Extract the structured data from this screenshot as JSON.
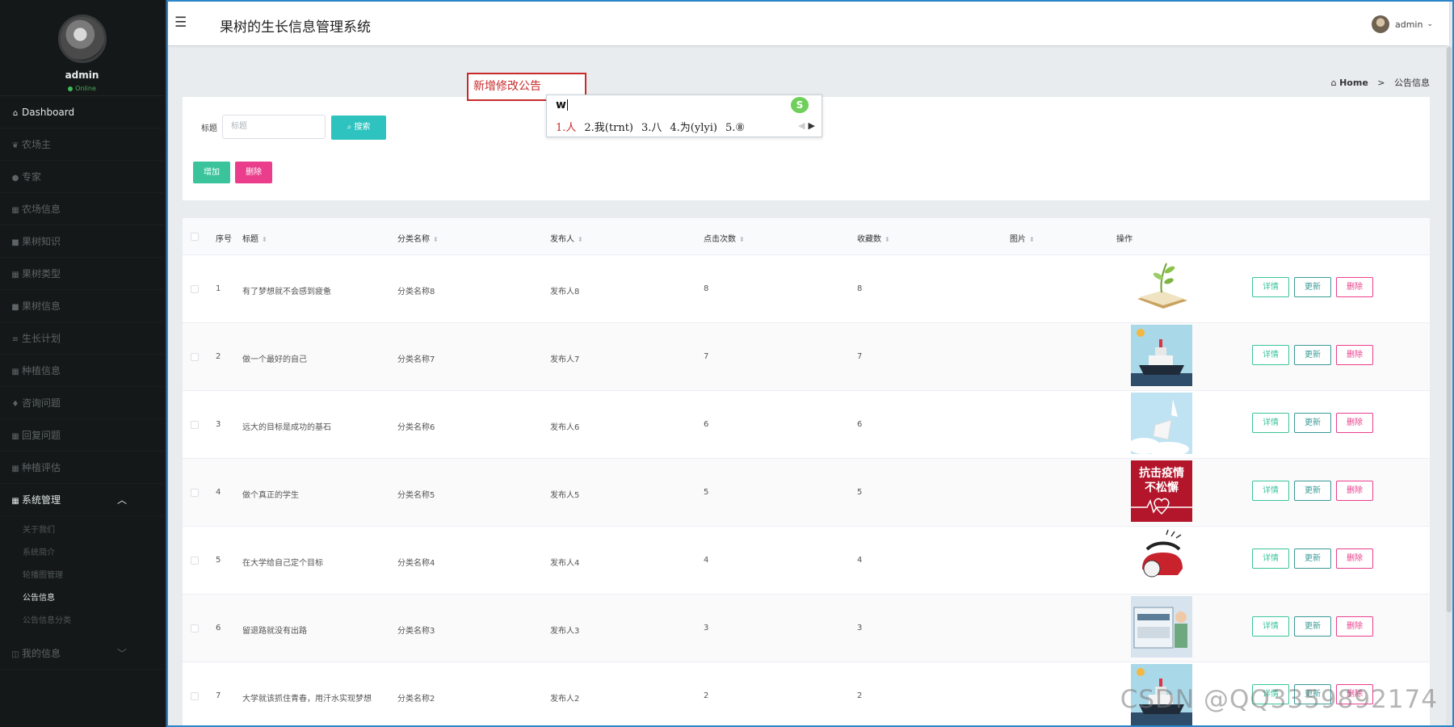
{
  "app": {
    "title": "果树的生长信息管理系统",
    "user": "admin"
  },
  "sidebar": {
    "profile": {
      "name": "admin",
      "status": "Online"
    },
    "items": [
      {
        "label": "Dashboard",
        "icon": "home-icon",
        "glyph": "⌂",
        "active": true
      },
      {
        "label": "农场主",
        "icon": "leaf-icon",
        "glyph": "❦"
      },
      {
        "label": "专家",
        "icon": "chat-icon",
        "glyph": "●"
      },
      {
        "label": "农场信息",
        "icon": "table-icon",
        "glyph": "▦"
      },
      {
        "label": "果树知识",
        "icon": "book-icon",
        "glyph": "■"
      },
      {
        "label": "果树类型",
        "icon": "grid-icon",
        "glyph": "▦"
      },
      {
        "label": "果树信息",
        "icon": "book-icon",
        "glyph": "■"
      },
      {
        "label": "生长计划",
        "icon": "list-icon",
        "glyph": "≡"
      },
      {
        "label": "种植信息",
        "icon": "grid-icon",
        "glyph": "▦"
      },
      {
        "label": "咨询问题",
        "icon": "pin-icon",
        "glyph": "♦"
      },
      {
        "label": "回复问题",
        "icon": "grid-icon",
        "glyph": "▦"
      },
      {
        "label": "种植评估",
        "icon": "grid-icon",
        "glyph": "▦"
      }
    ],
    "system": {
      "label": "系统管理",
      "icon": "grid-icon",
      "glyph": "▦",
      "sub": [
        "关于我们",
        "系统简介",
        "轮播图管理",
        "公告信息",
        "公告信息分类"
      ],
      "current": "公告信息"
    },
    "mine": {
      "label": "我的信息",
      "icon": "user-icon",
      "glyph": "◫"
    }
  },
  "annotation": {
    "text": "新增修改公告"
  },
  "breadcrumb": {
    "home": "Home",
    "sep": ">",
    "current": "公告信息"
  },
  "ime": {
    "code": "w",
    "candidates": [
      "1.人",
      "2.我(trnt)",
      "3.八",
      "4.为(ylyi)",
      "5.⑧"
    ],
    "logo": "S"
  },
  "search": {
    "label": "标题",
    "placeholder": "标题",
    "button": "搜索",
    "add": "增加",
    "delete": "删除"
  },
  "table": {
    "headers": {
      "index": "序号",
      "title": "标题",
      "category": "分类名称",
      "publisher": "发布人",
      "clicks": "点击次数",
      "favorites": "收藏数",
      "image": "图片",
      "actions": "操作"
    },
    "ops": {
      "detail": "详情",
      "edit": "更新",
      "remove": "删除"
    },
    "rows": [
      {
        "index": "1",
        "title": "有了梦想就不会感到疲惫",
        "category": "分类名称8",
        "publisher": "发布人8",
        "clicks": "8",
        "favorites": "8",
        "image": "book-plant"
      },
      {
        "index": "2",
        "title": "做一个最好的自己",
        "category": "分类名称7",
        "publisher": "发布人7",
        "clicks": "7",
        "favorites": "7",
        "image": "ship"
      },
      {
        "index": "3",
        "title": "远大的目标是成功的基石",
        "category": "分类名称6",
        "publisher": "发布人6",
        "clicks": "6",
        "favorites": "6",
        "image": "sky-paper"
      },
      {
        "index": "4",
        "title": "做个真正的学生",
        "category": "分类名称5",
        "publisher": "发布人5",
        "clicks": "5",
        "favorites": "5",
        "image": "poster-red"
      },
      {
        "index": "5",
        "title": "在大学给自己定个目标",
        "category": "分类名称4",
        "publisher": "发布人4",
        "clicks": "4",
        "favorites": "4",
        "image": "phone"
      },
      {
        "index": "6",
        "title": "留退路就没有出路",
        "category": "分类名称3",
        "publisher": "发布人3",
        "clicks": "3",
        "favorites": "3",
        "image": "winter-card"
      },
      {
        "index": "7",
        "title": "大学就该抓住青春，用汗水实现梦想",
        "category": "分类名称2",
        "publisher": "发布人2",
        "clicks": "2",
        "favorites": "2",
        "image": "ship"
      }
    ],
    "poster_text": [
      "抗击疫情",
      "不松懈"
    ]
  },
  "watermark": "CSDN @QQ3359892174",
  "colors": {
    "sidebar_bg": "#151818",
    "accent_teal": "#2ec3bf",
    "add_green": "#3bc49c",
    "delete_pink": "#ea3e8c",
    "selection_border": "#2a86c8",
    "annotation_red": "#c92b2b"
  }
}
